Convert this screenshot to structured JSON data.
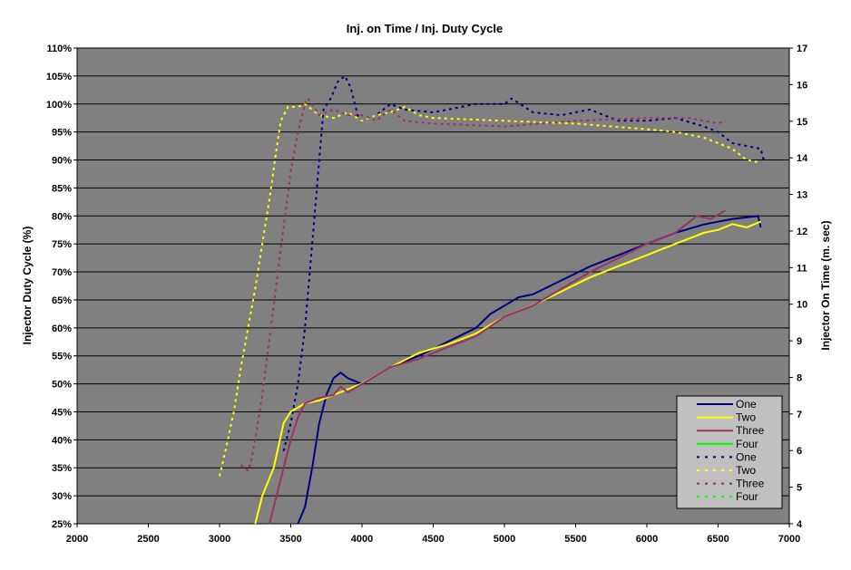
{
  "chart_data": {
    "type": "line",
    "title": "Inj. on Time / Inj. Duty Cycle",
    "xlabel": "",
    "ylabel": "Injector Duty Cycle (%)",
    "y2label": "Injector On Time (m. sec)",
    "xlim": [
      2000,
      7000
    ],
    "ylim": [
      25,
      110
    ],
    "y2lim": [
      4,
      17
    ],
    "xticks": [
      "2000",
      "2500",
      "3000",
      "3500",
      "4000",
      "4500",
      "5000",
      "5500",
      "6000",
      "6500",
      "7000"
    ],
    "yticks": [
      "25%",
      "30%",
      "35%",
      "40%",
      "45%",
      "50%",
      "55%",
      "60%",
      "65%",
      "70%",
      "75%",
      "80%",
      "85%",
      "90%",
      "95%",
      "100%",
      "105%",
      "110%"
    ],
    "y2ticks": [
      "4",
      "5",
      "6",
      "7",
      "8",
      "9",
      "10",
      "11",
      "12",
      "13",
      "14",
      "15",
      "16",
      "17"
    ],
    "grid": true,
    "legend_position": "bottom-right",
    "series": [
      {
        "name": "One",
        "axis": "right",
        "style": "solid",
        "color": "#000080",
        "x": [
          3550,
          3600,
          3650,
          3700,
          3750,
          3800,
          3850,
          3900,
          4000,
          4200,
          4400,
          4600,
          4800,
          4900,
          5000,
          5100,
          5200,
          5400,
          5600,
          5800,
          6000,
          6200,
          6400,
          6600,
          6780,
          6800
        ],
        "y": [
          4,
          4.46,
          5.53,
          6.75,
          7.52,
          7.98,
          8.13,
          7.98,
          7.82,
          8.28,
          8.59,
          8.97,
          9.35,
          9.73,
          9.96,
          10.19,
          10.27,
          10.65,
          11.03,
          11.34,
          11.65,
          11.95,
          12.18,
          12.33,
          12.41,
          12.1
        ]
      },
      {
        "name": "Two",
        "axis": "right",
        "style": "solid",
        "color": "#FFFF00",
        "x": [
          3250,
          3300,
          3380,
          3450,
          3500,
          3600,
          3700,
          3800,
          4000,
          4200,
          4400,
          4600,
          4800,
          5000,
          5200,
          5400,
          5600,
          5800,
          6000,
          6200,
          6400,
          6500,
          6600,
          6700,
          6800
        ],
        "y": [
          4,
          4.76,
          5.53,
          6.75,
          7.06,
          7.29,
          7.37,
          7.52,
          7.83,
          8.28,
          8.67,
          8.9,
          9.2,
          9.66,
          9.97,
          10.35,
          10.73,
          11.04,
          11.34,
          11.65,
          11.95,
          12.03,
          12.19,
          12.1,
          12.26
        ]
      },
      {
        "name": "Three",
        "axis": "right",
        "style": "solid",
        "color": "#993366",
        "x": [
          3350,
          3400,
          3450,
          3500,
          3550,
          3600,
          3700,
          3800,
          3850,
          3900,
          4000,
          4200,
          4400,
          4600,
          4800,
          5000,
          5200,
          5400,
          5600,
          5800,
          6000,
          6200,
          6350,
          6450,
          6550
        ],
        "y": [
          4,
          4.76,
          5.53,
          6.29,
          6.91,
          7.29,
          7.44,
          7.52,
          7.75,
          7.59,
          7.82,
          8.28,
          8.51,
          8.82,
          9.12,
          9.66,
          9.96,
          10.42,
          10.88,
          11.26,
          11.65,
          11.95,
          12.41,
          12.33,
          12.56
        ]
      },
      {
        "name": "Four",
        "axis": "right",
        "style": "solid",
        "color": "#00FF00",
        "x": [],
        "y": []
      },
      {
        "name": "One",
        "axis": "left",
        "style": "dashed",
        "color": "#000080",
        "x": [
          3450,
          3500,
          3550,
          3600,
          3650,
          3700,
          3730,
          3780,
          3830,
          3880,
          3920,
          3970,
          4000,
          4100,
          4200,
          4300,
          4500,
          4800,
          5000,
          5050,
          5200,
          5400,
          5600,
          5800,
          6000,
          6200,
          6400,
          6500,
          6600,
          6800,
          6820
        ],
        "y": [
          38,
          43,
          50,
          60,
          75,
          90,
          99,
          101,
          104,
          105,
          103,
          98,
          97,
          98,
          100,
          99,
          98.5,
          100,
          100,
          101,
          98.5,
          98,
          99,
          97,
          97,
          97.5,
          96,
          95,
          93,
          92,
          90
        ]
      },
      {
        "name": "Two",
        "axis": "left",
        "style": "dashed",
        "color": "#FFFF00",
        "x": [
          3000,
          3050,
          3100,
          3150,
          3200,
          3250,
          3300,
          3350,
          3400,
          3430,
          3480,
          3550,
          3600,
          3700,
          3800,
          3900,
          4000,
          4100,
          4200,
          4300,
          4400,
          4500,
          5000,
          5500,
          6000,
          6200,
          6400,
          6500,
          6600,
          6700,
          6800
        ],
        "y": [
          33.5,
          39,
          45,
          53,
          60,
          67,
          75,
          83,
          92,
          97,
          99.5,
          99.5,
          100,
          98,
          97.5,
          98.5,
          97,
          98,
          98.5,
          99.5,
          98,
          97.5,
          97,
          96.5,
          95.5,
          95,
          94,
          93,
          92,
          90,
          89.5
        ]
      },
      {
        "name": "Three",
        "axis": "left",
        "style": "dashed",
        "color": "#993366",
        "x": [
          3150,
          3200,
          3220,
          3250,
          3300,
          3350,
          3400,
          3450,
          3500,
          3550,
          3600,
          3620,
          3700,
          3800,
          3900,
          4000,
          4100,
          4200,
          4300,
          4500,
          5000,
          5500,
          6000,
          6300,
          6500,
          6550
        ],
        "y": [
          35.5,
          34.5,
          36,
          40,
          48,
          58,
          68,
          78,
          88,
          95,
          100,
          101,
          98,
          99,
          98,
          98,
          97,
          99,
          97,
          96.5,
          96,
          97,
          97.5,
          97.5,
          96.5,
          97
        ]
      },
      {
        "name": "Four",
        "axis": "left",
        "style": "dashed",
        "color": "#00FF00",
        "x": [],
        "y": []
      }
    ]
  }
}
